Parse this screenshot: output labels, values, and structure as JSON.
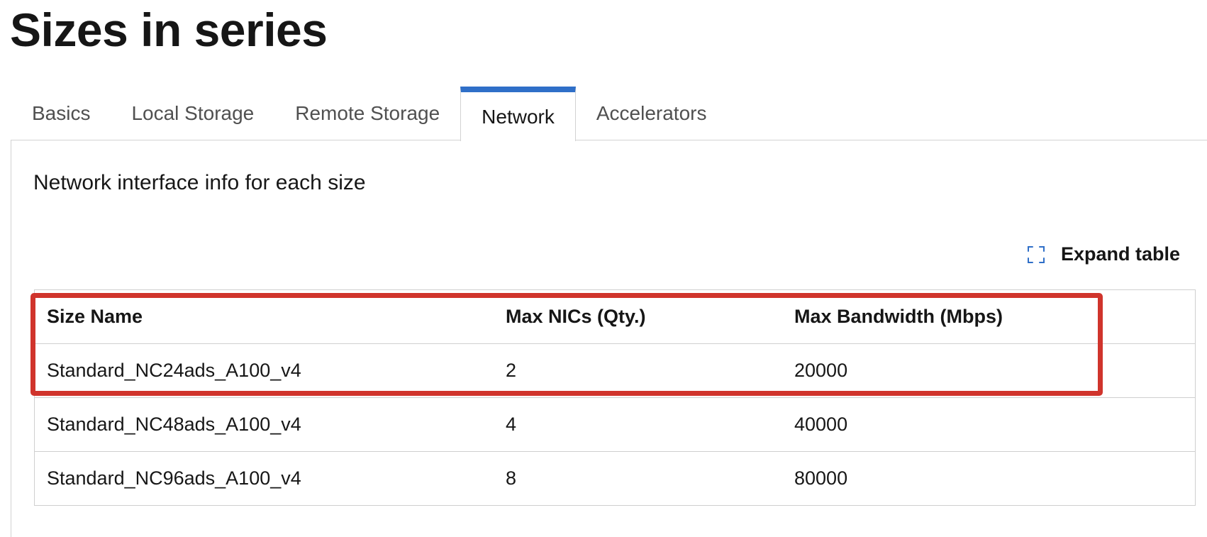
{
  "page": {
    "title": "Sizes in series"
  },
  "tabs": [
    {
      "label": "Basics",
      "active": false
    },
    {
      "label": "Local Storage",
      "active": false
    },
    {
      "label": "Remote Storage",
      "active": false
    },
    {
      "label": "Network",
      "active": true
    },
    {
      "label": "Accelerators",
      "active": false
    }
  ],
  "panel": {
    "description": "Network interface info for each size",
    "expand_label": "Expand table",
    "expand_icon": "expand-icon"
  },
  "table": {
    "headers": [
      "Size Name",
      "Max NICs (Qty.)",
      "Max Bandwidth (Mbps)"
    ],
    "rows": [
      [
        "Standard_NC24ads_A100_v4",
        "2",
        "20000"
      ],
      [
        "Standard_NC48ads_A100_v4",
        "4",
        "40000"
      ],
      [
        "Standard_NC96ads_A100_v4",
        "8",
        "80000"
      ]
    ]
  },
  "colors": {
    "accent": "#2f6fc8",
    "highlight": "#d0342c",
    "border": "#cfcfcf"
  }
}
